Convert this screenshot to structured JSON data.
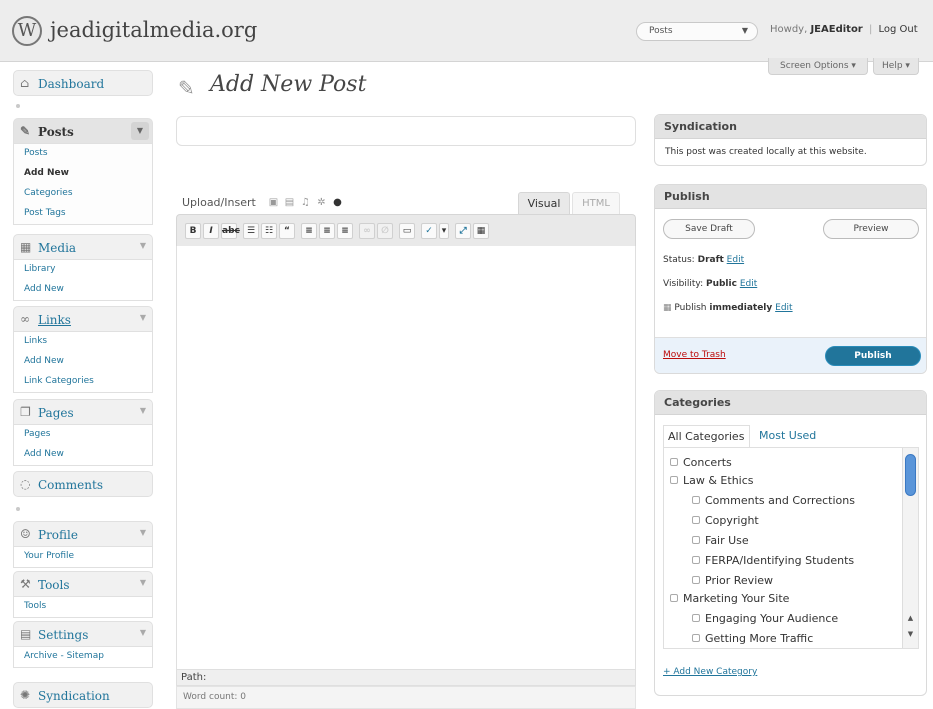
{
  "header": {
    "logo_glyph": "W",
    "site_title": "jeadigitalmedia.org",
    "favorites_selected": "Posts",
    "howdy_prefix": "Howdy,",
    "username": "JEAEditor",
    "separator": "|",
    "logout": "Log Out",
    "screen_options": "Screen Options",
    "help": "Help"
  },
  "menu": {
    "dashboard": "Dashboard",
    "posts": "Posts",
    "posts_sub": [
      "Posts",
      "Add New",
      "Categories",
      "Post Tags"
    ],
    "media": "Media",
    "media_sub": [
      "Library",
      "Add New"
    ],
    "links": "Links",
    "links_sub": [
      "Links",
      "Add New",
      "Link Categories"
    ],
    "pages": "Pages",
    "pages_sub": [
      "Pages",
      "Add New"
    ],
    "comments": "Comments",
    "profile": "Profile",
    "profile_sub": [
      "Your Profile"
    ],
    "tools": "Tools",
    "tools_sub": [
      "Tools"
    ],
    "settings": "Settings",
    "settings_sub": [
      "Archive - Sitemap"
    ],
    "syndication": "Syndication"
  },
  "page": {
    "title": "Add New Post"
  },
  "editor": {
    "title_value": "",
    "upload_label": "Upload/Insert",
    "tab_visual": "Visual",
    "tab_html": "HTML",
    "path_label": "Path:",
    "word_count": "Word count: 0"
  },
  "syndication_box": {
    "title": "Syndication",
    "text": "This post was created locally at this website."
  },
  "publish_box": {
    "title": "Publish",
    "save_draft": "Save Draft",
    "preview": "Preview",
    "status_label": "Status:",
    "status_value": "Draft",
    "visibility_label": "Visibility:",
    "visibility_value": "Public",
    "publish_label": "Publish",
    "publish_value": "immediately",
    "edit": "Edit",
    "move_to_trash": "Move to Trash",
    "publish_button": "Publish"
  },
  "categories_box": {
    "title": "Categories",
    "tab_all": "All Categories",
    "tab_most_used": "Most Used",
    "items": [
      {
        "label": "Concerts",
        "level": 0
      },
      {
        "label": "Law & Ethics",
        "level": 0
      },
      {
        "label": "Comments and Corrections",
        "level": 1
      },
      {
        "label": "Copyright",
        "level": 1
      },
      {
        "label": "Fair Use",
        "level": 1
      },
      {
        "label": "FERPA/Identifying Students",
        "level": 1
      },
      {
        "label": "Prior Review",
        "level": 1
      },
      {
        "label": "Marketing Your Site",
        "level": 0
      },
      {
        "label": "Engaging Your Audience",
        "level": 1
      },
      {
        "label": "Getting More Traffic",
        "level": 1
      }
    ],
    "add_new": "+ Add New Category"
  },
  "colors": {
    "link": "#21759b",
    "publish_button": "#21759b",
    "trash": "#bc0b0b"
  }
}
